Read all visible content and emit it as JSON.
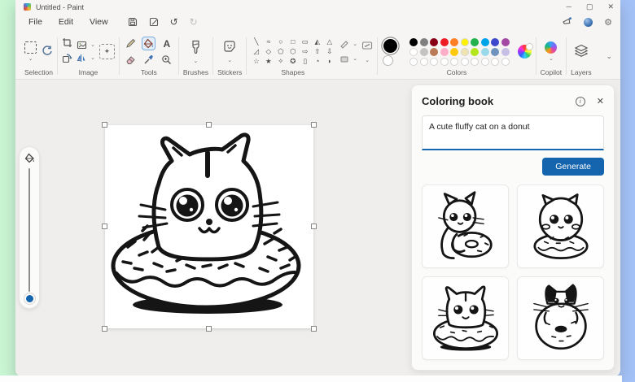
{
  "accent": "#1464ae",
  "window": {
    "title": "Untitled - Paint",
    "controls": {
      "minimize": "─",
      "maximize": "▢",
      "close": "✕"
    }
  },
  "menu": {
    "items": [
      "File",
      "Edit",
      "View"
    ],
    "undo_glyph": "↺",
    "redo_glyph": "↻",
    "settings_glyph": "⚙"
  },
  "ribbon": {
    "groups": {
      "selection": "Selection",
      "image": "Image",
      "tools": "Tools",
      "brushes": "Brushes",
      "stickers": "Stickers",
      "shapes": "Shapes",
      "colors": "Colors",
      "copilot": "Copilot",
      "layers": "Layers"
    },
    "text_tool_label": "A",
    "sticker_glyph": "☺",
    "shape_glyphs": [
      "╲",
      "≈",
      "○",
      "□",
      "▭",
      "◭",
      "△",
      "◿",
      "◇",
      "⬠",
      "⬡",
      "⇨",
      "⇧",
      "⇩",
      "☆",
      "★",
      "✧",
      "✪",
      "▯",
      "◔",
      "◗"
    ]
  },
  "colors": {
    "primary": "#000000",
    "secondary": "#ffffff",
    "row1": [
      "#000000",
      "#7f7f7f",
      "#880015",
      "#ed1c24",
      "#ff7f27",
      "#fff200",
      "#22b14c",
      "#00a2e8",
      "#3f48cc",
      "#a349a4"
    ],
    "row2": [
      "#ffffff",
      "#c3c3c3",
      "#b97a57",
      "#ffaec9",
      "#ffc90e",
      "#efe4b0",
      "#b5e61d",
      "#99d9ea",
      "#7092be",
      "#c8bfe7"
    ],
    "empty_count": 10
  },
  "panel": {
    "title": "Coloring book",
    "prompt": "A cute fluffy cat on a donut",
    "generate_label": "Generate",
    "thumbnails": [
      "cat-hugging-donut",
      "fluffy-cat-sitting-on-donut",
      "cat-head-in-donut",
      "black-white-cat-behind-donut"
    ]
  },
  "canvas": {
    "subject": "Line-art drawing of a cute cat sitting inside a sprinkled donut"
  }
}
